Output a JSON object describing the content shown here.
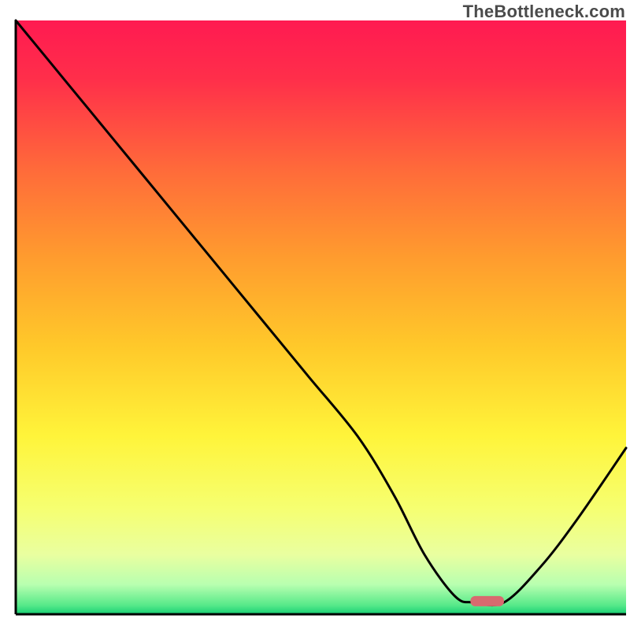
{
  "watermark": "TheBottleneck.com",
  "chart_data": {
    "type": "line",
    "title": "",
    "xlabel": "",
    "ylabel": "",
    "xlim": [
      0,
      100
    ],
    "ylim": [
      0,
      100
    ],
    "grid": false,
    "legend": false,
    "curve": {
      "name": "bottleneck-curve",
      "x": [
        0,
        8,
        16,
        24,
        32,
        40,
        48,
        56,
        62,
        67,
        72,
        75,
        80,
        86,
        92,
        100
      ],
      "y": [
        100,
        90,
        80,
        70,
        60,
        50,
        40,
        30,
        20,
        10,
        3,
        2,
        2,
        8,
        16,
        28
      ]
    },
    "marker": {
      "name": "optimal-zone",
      "x_start": 74.5,
      "x_end": 80,
      "y": 2.2,
      "color": "#d86a6f"
    },
    "background_gradient": {
      "stops": [
        {
          "offset": 0.0,
          "color": "#ff1a51"
        },
        {
          "offset": 0.1,
          "color": "#ff2f4a"
        },
        {
          "offset": 0.25,
          "color": "#ff6a3a"
        },
        {
          "offset": 0.4,
          "color": "#ff9c2e"
        },
        {
          "offset": 0.55,
          "color": "#ffc92a"
        },
        {
          "offset": 0.7,
          "color": "#fff43a"
        },
        {
          "offset": 0.82,
          "color": "#f6ff70"
        },
        {
          "offset": 0.9,
          "color": "#e9ffa0"
        },
        {
          "offset": 0.95,
          "color": "#b8ffb0"
        },
        {
          "offset": 0.985,
          "color": "#56e989"
        },
        {
          "offset": 1.0,
          "color": "#17cf74"
        }
      ]
    },
    "axes": {
      "color": "#000000",
      "width": 3
    }
  }
}
